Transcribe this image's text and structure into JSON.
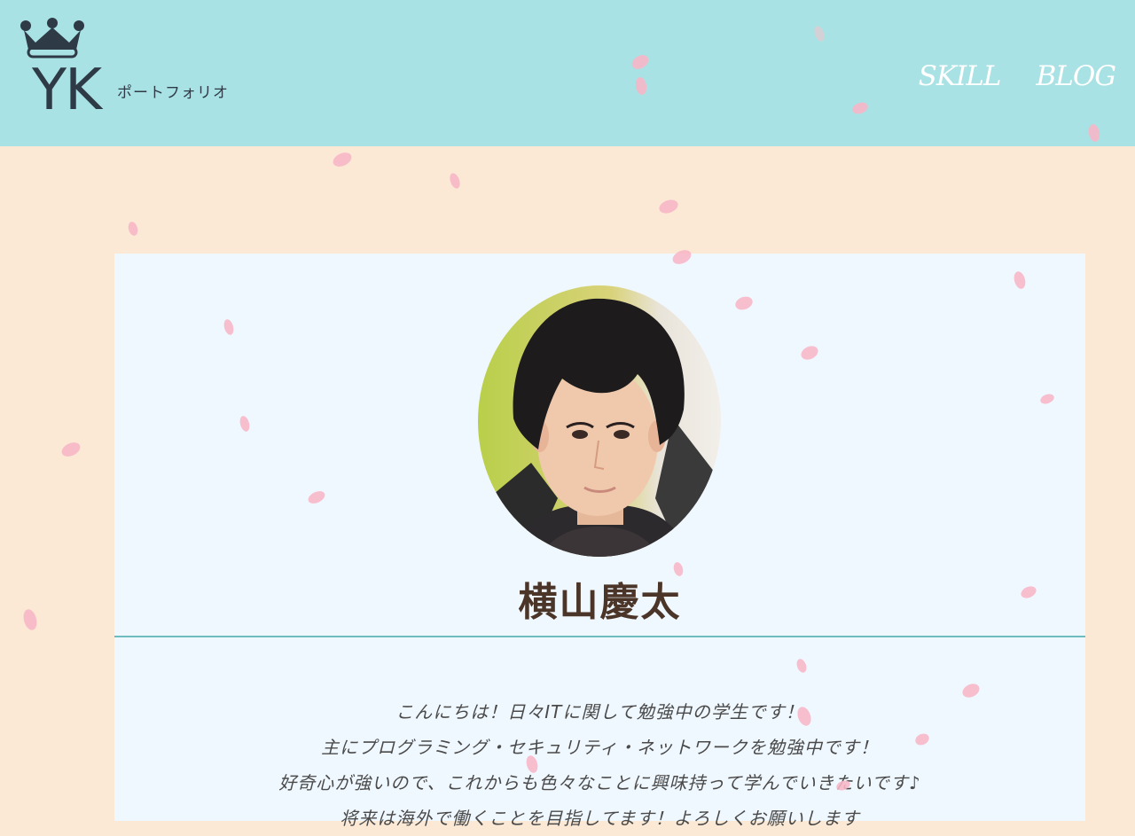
{
  "header": {
    "logo_mark": "YK",
    "logo_sub": "ポートフォリオ",
    "nav": [
      "SKILL",
      "BLOG"
    ]
  },
  "profile": {
    "name": "横山慶太",
    "bio": [
      "こんにちは！日々ITに関して勉強中の学生です！",
      "主にプログラミング・セキュリティ・ネットワークを勉強中です！",
      "好奇心が強いので、これからも色々なことに興味持って学んでいきたいです♪",
      "将来は海外で働くことを目指してます！よろしくお願いします"
    ]
  },
  "icons": [
    "crown-icon",
    "profile-photo",
    "sakura-petal"
  ],
  "colors": {
    "header_bg": "#a9e2e4",
    "page_bg": "#fbe9d5",
    "card_bg": "#f0f8ff",
    "divider": "#6dbcbe",
    "name_text": "#4a3528",
    "petal": "#f8b7c8"
  }
}
